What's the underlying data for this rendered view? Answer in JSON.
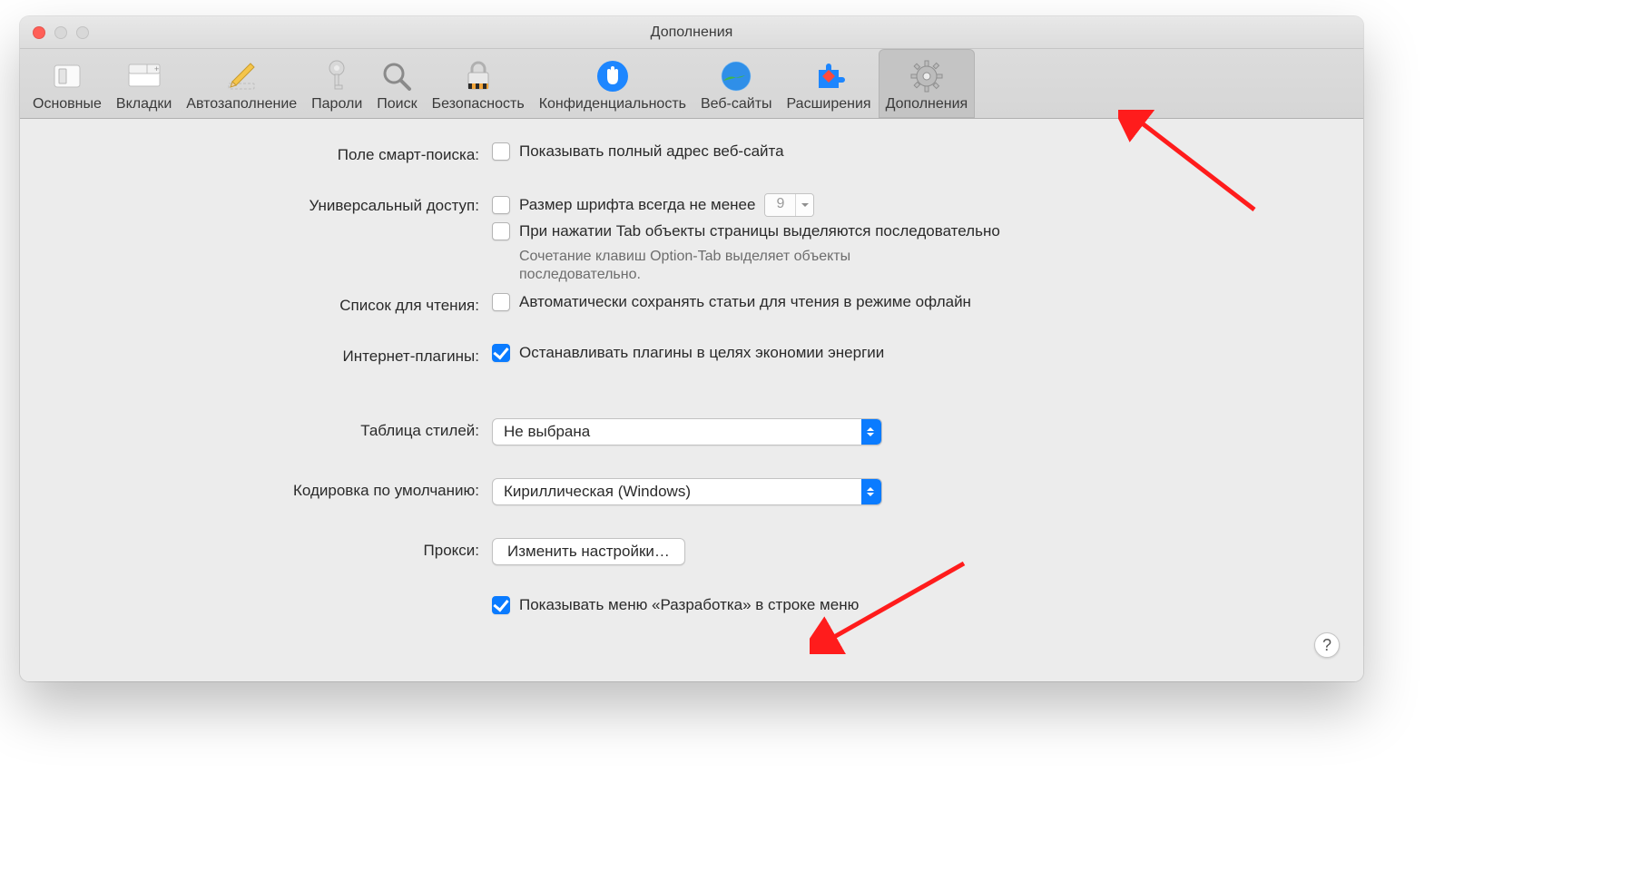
{
  "window": {
    "title": "Дополнения"
  },
  "toolbar": {
    "tabs": [
      {
        "label": "Основные",
        "icon": "switch-icon"
      },
      {
        "label": "Вкладки",
        "icon": "tabs-icon"
      },
      {
        "label": "Автозаполнение",
        "icon": "pencil-icon"
      },
      {
        "label": "Пароли",
        "icon": "key-icon"
      },
      {
        "label": "Поиск",
        "icon": "search-icon"
      },
      {
        "label": "Безопасность",
        "icon": "lock-icon"
      },
      {
        "label": "Конфиденциальность",
        "icon": "hand-icon"
      },
      {
        "label": "Веб-сайты",
        "icon": "globe-icon"
      },
      {
        "label": "Расширения",
        "icon": "puzzle-icon"
      },
      {
        "label": "Дополнения",
        "icon": "gear-icon"
      }
    ]
  },
  "rows": {
    "smart_search": {
      "label": "Поле смарт-поиска:",
      "cb_show_full_url": {
        "checked": false,
        "text": "Показывать полный адрес веб-сайта"
      }
    },
    "universal_access": {
      "label": "Универсальный доступ:",
      "cb_min_font": {
        "checked": false,
        "text": "Размер шрифта всегда не менее",
        "value": "9"
      },
      "cb_tab_highlight": {
        "checked": false,
        "text": "При нажатии Tab объекты страницы выделяются последовательно"
      },
      "hint": "Сочетание клавиш Option-Tab выделяет объекты последовательно."
    },
    "reading_list": {
      "label": "Список для чтения:",
      "cb_save_offline": {
        "checked": false,
        "text": "Автоматически сохранять статьи для чтения в режиме офлайн"
      }
    },
    "internet_plugins": {
      "label": "Интернет-плагины:",
      "cb_stop_plugins": {
        "checked": true,
        "text": "Останавливать плагины в целях экономии энергии"
      }
    },
    "style_sheet": {
      "label": "Таблица стилей:",
      "value": "Не выбрана"
    },
    "default_encoding": {
      "label": "Кодировка по умолчанию:",
      "value": "Кириллическая (Windows)"
    },
    "proxies": {
      "label": "Прокси:",
      "button": "Изменить настройки…"
    },
    "develop_menu": {
      "checked": true,
      "text": "Показывать меню «Разработка» в строке меню"
    }
  },
  "help": "?"
}
